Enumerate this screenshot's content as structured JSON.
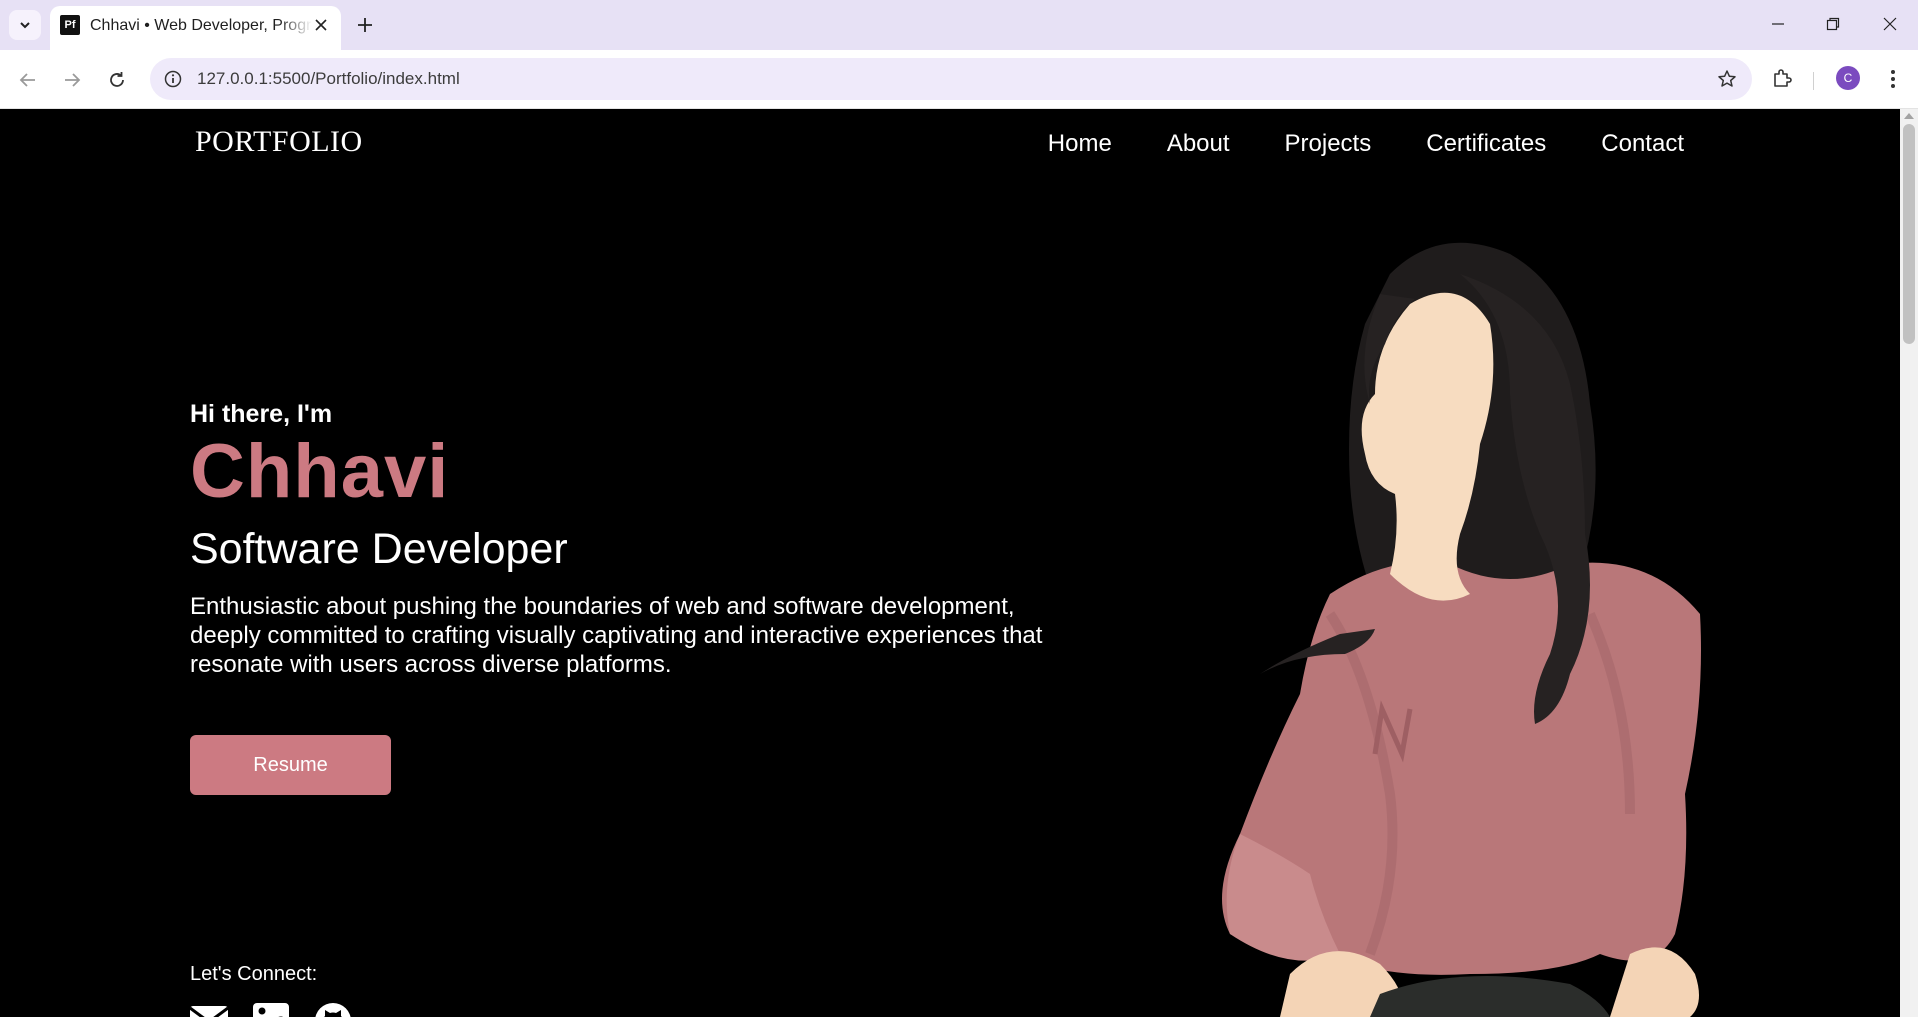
{
  "browser": {
    "tab_title": "Chhavi • Web Developer, Programmer",
    "tab_favicon_text": "Pf",
    "url": "127.0.0.1:5500/Portfolio/index.html",
    "profile_initial": "C"
  },
  "header": {
    "logo": "PORTFOLIO",
    "nav": [
      "Home",
      "About",
      "Projects",
      "Certificates",
      "Contact"
    ]
  },
  "hero": {
    "greeting": "Hi there, I'm",
    "name": "Chhavi",
    "role": "Software Developer",
    "description": "Enthusiastic about pushing the boundaries of web and software development, deeply committed to crafting visually captivating and interactive experiences that resonate with users across diverse platforms.",
    "resume_label": "Resume",
    "connect_label": "Let's Connect:",
    "socials": [
      "mail-icon",
      "linkedin-icon",
      "github-icon"
    ]
  },
  "colors": {
    "accent": "#cc7a82",
    "background": "#000000",
    "chrome": "#e7e1f5"
  }
}
